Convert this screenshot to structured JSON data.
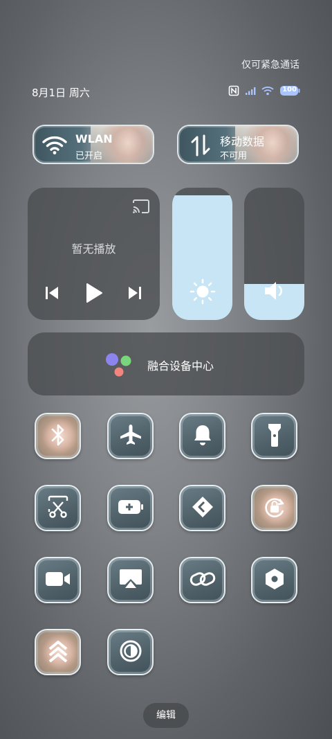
{
  "status_bar": {
    "emergency_text": "仅可紧急通话",
    "date": "8月1日 周六",
    "battery": "100",
    "icons": [
      "nfc-icon",
      "signal-icon",
      "wifi-icon",
      "battery-icon"
    ]
  },
  "top_cards": {
    "wlan": {
      "title": "WLAN",
      "subtitle": "已开启",
      "icon": "wifi-icon"
    },
    "mobile_data": {
      "title": "移动数据",
      "subtitle": "不可用",
      "icon": "data-transfer-icon"
    }
  },
  "media": {
    "empty_text": "暂无播放",
    "icons": [
      "cast-icon",
      "previous-icon",
      "play-icon",
      "next-icon"
    ]
  },
  "brightness": {
    "level": 0.94,
    "icon": "sun-icon"
  },
  "volume": {
    "level": 0.27,
    "icon": "speaker-icon"
  },
  "device_hub": {
    "label": "融合设备中心",
    "icon": "device-hub-icon"
  },
  "toggles": [
    {
      "name": "bluetooth",
      "icon": "bluetooth-icon"
    },
    {
      "name": "airplane",
      "icon": "airplane-icon"
    },
    {
      "name": "bell",
      "icon": "bell-icon"
    },
    {
      "name": "flashlight",
      "icon": "flashlight-icon"
    },
    {
      "name": "screenshot",
      "icon": "scissors-icon"
    },
    {
      "name": "battery-saver",
      "icon": "battery-plus-icon"
    },
    {
      "name": "share",
      "icon": "share-icon"
    },
    {
      "name": "rotation-lock",
      "icon": "rotation-lock-icon"
    },
    {
      "name": "screen-record",
      "icon": "video-icon"
    },
    {
      "name": "screen-cast",
      "icon": "screencast-icon"
    },
    {
      "name": "link",
      "icon": "link-icon"
    },
    {
      "name": "settings",
      "icon": "hex-settings-icon"
    },
    {
      "name": "boost",
      "icon": "chevrons-up-icon"
    },
    {
      "name": "dark-mode",
      "icon": "contrast-icon"
    }
  ],
  "edit_button": {
    "label": "编辑"
  },
  "colors": {
    "slider_fill": "#c7e5f5",
    "panel": "#4a4d50"
  }
}
